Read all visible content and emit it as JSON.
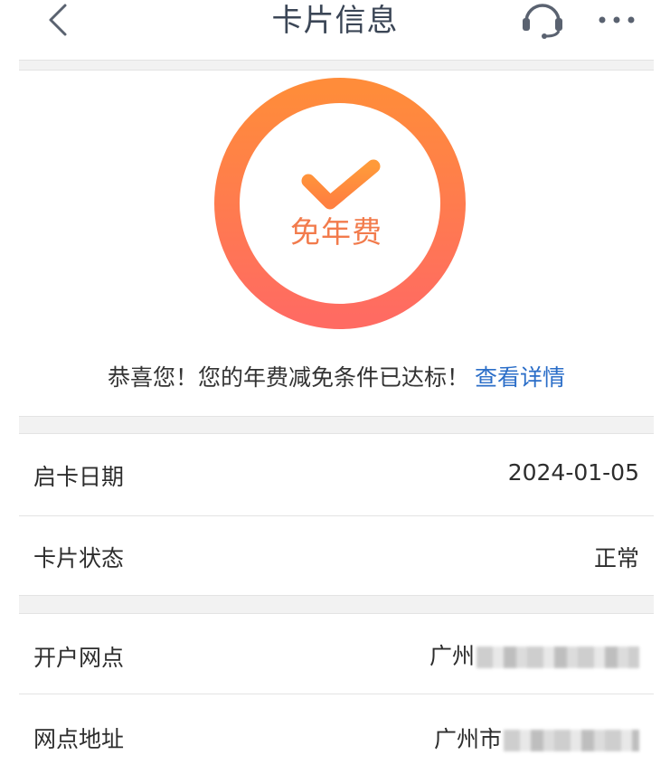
{
  "header": {
    "title": "卡片信息",
    "back_icon": "chevron-left-icon",
    "support_icon": "headset-icon",
    "more_icon": "more-dots-icon"
  },
  "badge": {
    "label": "免年费",
    "icon": "checkmark-icon",
    "ring_color_start": "#ff8c3a",
    "ring_color_end": "#ff6b62",
    "text_color": "#f27b4c"
  },
  "notice": {
    "text": "恭喜您！您的年费减免条件已达标！",
    "link": "查看详情",
    "link_color": "#2b6ec8"
  },
  "card_info": [
    {
      "label": "启卡日期",
      "value": "2024-01-05"
    },
    {
      "label": "卡片状态",
      "value": "正常"
    }
  ],
  "branch_info": [
    {
      "label": "开户网点",
      "value_prefix": "广州"
    },
    {
      "label": "网点地址",
      "value_prefix": "广州市"
    }
  ]
}
